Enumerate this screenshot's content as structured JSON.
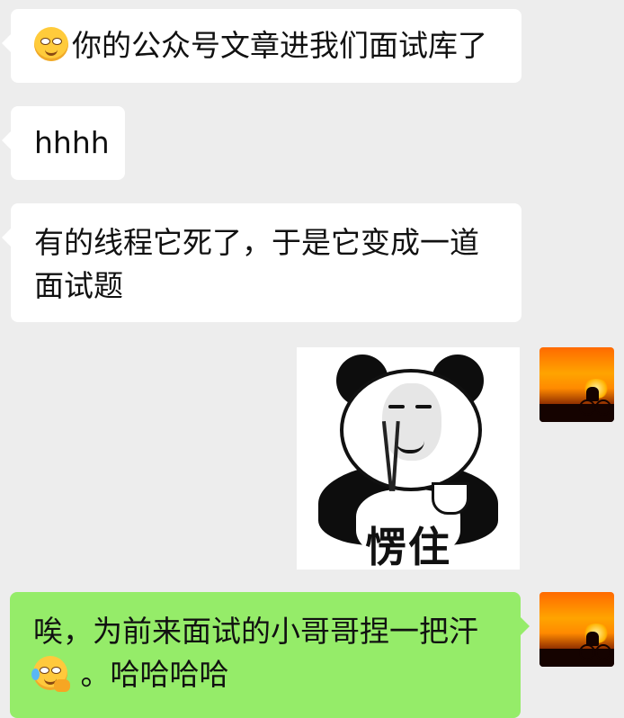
{
  "messages": [
    {
      "side": "left",
      "emoji": "blushing-face",
      "text": "你的公众号文章进我们面试库了"
    },
    {
      "side": "left",
      "text": "hhhh"
    },
    {
      "side": "left",
      "lines": [
        "有的线程它死了，于是它变成一道",
        "面试题"
      ]
    },
    {
      "side": "right",
      "type": "sticker",
      "sticker_icon": "panda-meme-sticker",
      "sticker_text": "愣住"
    },
    {
      "side": "right",
      "lines": [
        "唉，为前来面试的小哥哥捏一把汗",
        " 。哈哈哈哈"
      ],
      "emoji": "laughing-crying-face"
    }
  ],
  "colors": {
    "background": "#ededed",
    "left_bubble": "#ffffff",
    "right_bubble": "#95ec69"
  },
  "avatar_icon": "sunset-cyclist-avatar"
}
